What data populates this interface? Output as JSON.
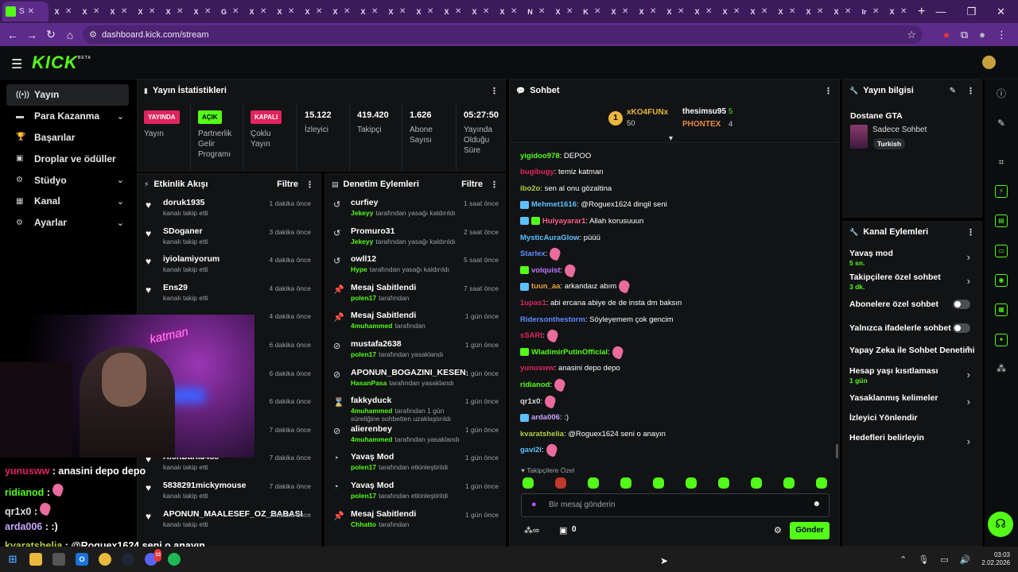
{
  "browser": {
    "active_tab_label": "S",
    "tabs": [
      "X",
      "X",
      "X",
      "X",
      "X",
      "X",
      "G",
      "X",
      "X",
      "X",
      "X",
      "X",
      "X",
      "X",
      "X",
      "X",
      "X",
      "N",
      "X",
      "K",
      "X",
      "X",
      "X",
      "X",
      "X",
      "X",
      "X",
      "X",
      "X",
      "Ir",
      "X"
    ],
    "url": "dashboard.kick.com/stream"
  },
  "logo": {
    "text": "KICK",
    "tag": "BETA"
  },
  "sidebar": {
    "items": [
      {
        "label": "Yayın",
        "icon": "broadcast-icon"
      },
      {
        "label": "Para Kazanma",
        "icon": "money-icon"
      },
      {
        "label": "Başarılar",
        "icon": "trophy-icon"
      },
      {
        "label": "Droplar ve ödüller",
        "icon": "gift-icon"
      },
      {
        "label": "Stüdyo",
        "icon": "studio-icon"
      },
      {
        "label": "Kanal",
        "icon": "channel-icon"
      },
      {
        "label": "Ayarlar",
        "icon": "gear-icon"
      }
    ]
  },
  "stats": {
    "title": "Yayın İstatistikleri",
    "cells": [
      {
        "badge": "YAYINDA",
        "label": "Yayın"
      },
      {
        "badge": "AÇIK",
        "label": "Partnerlik Gelir Programı"
      },
      {
        "badge": "KAPALI",
        "label": "Çoklu Yayın"
      },
      {
        "value": "15.122",
        "label": "İzleyici"
      },
      {
        "value": "419.420",
        "label": "Takipçi"
      },
      {
        "value": "1.626",
        "label": "Abone Sayısı"
      },
      {
        "value": "05:27:50",
        "label": "Yayında Olduğu Süre"
      }
    ]
  },
  "activity": {
    "title": "Etkinlik Akışı",
    "filter": "Filtre",
    "items": [
      {
        "name": "doruk1935",
        "sub": "kanalı takip etti",
        "time": "1 dakika önce"
      },
      {
        "name": "SDoganer",
        "sub": "kanalı takip etti",
        "time": "3 dakika önce"
      },
      {
        "name": "iyiolamiyorum",
        "sub": "kanalı takip etti",
        "time": "4 dakika önce"
      },
      {
        "name": "Ens29",
        "sub": "kanalı takip etti",
        "time": "4 dakika önce"
      },
      {
        "name": "",
        "sub": "",
        "time": "4 dakika önce"
      },
      {
        "name": "",
        "sub": "",
        "time": "6 dakika önce"
      },
      {
        "name": "",
        "sub": "",
        "time": "6 dakika önce"
      },
      {
        "name": "",
        "sub": "",
        "time": "6 dakika önce"
      },
      {
        "name": "",
        "sub": "",
        "time": "7 dakika önce"
      },
      {
        "name": "AlonDark3458",
        "sub": "kanalı takip etti",
        "time": "7 dakika önce"
      },
      {
        "name": "5838291mickymouse",
        "sub": "kanalı takip etti",
        "time": "7 dakika önce"
      },
      {
        "name": "APONUN_MAALESEF_OZ_BABASI",
        "sub": "kanalı takip etti",
        "time": "7 dakika önce"
      }
    ]
  },
  "moderation": {
    "title": "Denetim Eylemleri",
    "filter": "Filtre",
    "items": [
      {
        "icon": "undo-icon",
        "name": "curfiey",
        "mod": "Jekeyy",
        "action": "tarafından yasağı kaldırıldı",
        "time": "1 saat önce"
      },
      {
        "icon": "undo-icon",
        "name": "Promuro31",
        "mod": "Jekeyy",
        "action": "tarafından yasağı kaldırıldı",
        "time": "2 saat önce"
      },
      {
        "icon": "undo-icon",
        "name": "owll12",
        "mod": "Hype",
        "action": "tarafından yasağı kaldırıldı",
        "time": "5 saat önce"
      },
      {
        "icon": "pin-icon",
        "name": "Mesaj Sabitlendi",
        "mod": "polen17",
        "action": "tarafından",
        "time": "7 saat önce"
      },
      {
        "icon": "pin-icon",
        "name": "Mesaj Sabitlendi",
        "mod": "4muhammed",
        "action": "tarafından",
        "time": "1 gün önce"
      },
      {
        "icon": "ban-icon",
        "name": "mustafa2638",
        "mod": "polen17",
        "action": "tarafından yasaklandı",
        "time": "1 gün önce"
      },
      {
        "icon": "ban-icon",
        "name": "APONUN_BOGAZINI_KESEN",
        "mod": "HasanPasa",
        "action": "tarafından yasaklandı",
        "time": "1 gün önce"
      },
      {
        "icon": "hourglass-icon",
        "name": "fakkyduck",
        "mod": "4muhammed",
        "action": "tarafından 1 gün süreliğine sohbetten uzaklaştırıldı",
        "time": "1 gün önce"
      },
      {
        "icon": "ban-icon",
        "name": "alierenbey",
        "mod": "4muhammed",
        "action": "tarafından yasaklandı",
        "time": "1 gün önce"
      },
      {
        "icon": "snail-icon",
        "name": "Yavaş Mod",
        "mod": "polen17",
        "action": "tarafından etkinleştirildi",
        "time": "1 gün önce"
      },
      {
        "icon": "snail-icon",
        "name": "Yavaş Mod",
        "mod": "polen17",
        "action": "tarafından etkinleştirildi",
        "time": "1 gün önce"
      },
      {
        "icon": "pin-icon",
        "name": "Mesaj Sabitlendi",
        "mod": "Chhatto",
        "action": "tarafından",
        "time": "1 gün önce"
      }
    ]
  },
  "chat": {
    "title": "Sohbet",
    "leaders": [
      {
        "name": "xKO4FUNx",
        "count": "50"
      },
      {
        "name": "thesimsu95",
        "count": "5"
      },
      {
        "name": "PHONTEX",
        "count": "4"
      }
    ],
    "messages": [
      {
        "user": "yigidoo978",
        "color": "#53fc18",
        "text": ": DEPOO"
      },
      {
        "user": "bugibugy",
        "color": "#e0245e",
        "text": ": temiz katman"
      },
      {
        "user": "ibo2o",
        "color": "#b5cf3e",
        "text": ": sen al onu gözaltina"
      },
      {
        "user": "Mehmet1616",
        "color": "#5ec1ff",
        "text": ": @Roguex1624 dingil seni",
        "badge": "b"
      },
      {
        "user": "Hulyayarar1",
        "color": "#ff5f8a",
        "text": ": Allah korusuuun",
        "badge": "bg"
      },
      {
        "user": "MysticAuraGlow",
        "color": "#5ec1ff",
        "text": ": püüü"
      },
      {
        "user": "Starlex",
        "color": "#5e8cff",
        "text": ":",
        "emote": true
      },
      {
        "user": "volquist",
        "color": "#c275ff",
        "text": ":",
        "emote": true,
        "badge": "g"
      },
      {
        "user": "tuun_aa",
        "color": "#e6a23c",
        "text": ": arkandaız abım",
        "emote": true,
        "badge": "b"
      },
      {
        "user": "1upas1",
        "color": "#e0245e",
        "text": ": abi ercana abiye de de insta dm baksın"
      },
      {
        "user": "Ridersonthestorm",
        "color": "#5e8cff",
        "text": ": Söyleyemem çok gencim"
      },
      {
        "user": "sSARI",
        "color": "#e0245e",
        "text": ":",
        "emote": true
      },
      {
        "user": "WladimirPutinOfficial",
        "color": "#53fc18",
        "text": ":",
        "emote": true,
        "badge": "g"
      },
      {
        "user": "yunusww",
        "color": "#e0245e",
        "text": ": anasini depo depo"
      },
      {
        "user": "ridianod",
        "color": "#53fc18",
        "text": ":",
        "emote": true
      },
      {
        "user": "qr1x0",
        "color": "#ddd",
        "text": ":",
        "emote": true
      },
      {
        "user": "arda006",
        "color": "#c9a6ff",
        "text": ": :)",
        "badge": "b"
      },
      {
        "user": "kvaratshelia",
        "color": "#b5cf3e",
        "text": ": @Roguex1624 seni o anayın"
      },
      {
        "user": "gavi2i",
        "color": "#5ec1ff",
        "text": ":",
        "emote": true
      }
    ],
    "followers_only": "Takipçilere Özel",
    "placeholder": "Bir mesaj gönderin",
    "points": "0",
    "send": "Gönder"
  },
  "overlay_chat": [
    {
      "user": "yunusww",
      "text": " : anasini depo depo"
    },
    {
      "user": "ridianod",
      "text": " :"
    },
    {
      "user": "qr1x0",
      "text": " :"
    },
    {
      "user": "arda006",
      "text": " : :)"
    },
    {
      "user": "kvaratshelia",
      "text": " : @Roguex1624 seni o anayın"
    }
  ],
  "webcam_neon": "katman",
  "stream_info": {
    "title": "Yayın bilgisi",
    "stream_title": "Dostane GTA",
    "category": "Sadece Sohbet",
    "tag": "Turkish"
  },
  "channel_actions": {
    "title": "Kanal Eylemleri",
    "items": [
      {
        "label": "Yavaş mod",
        "sub": "5 sn.",
        "ctl": "arrow"
      },
      {
        "label": "Takipçilere özel sohbet",
        "sub": "3 dk.",
        "ctl": "arrow"
      },
      {
        "label": "Abonelere özel sohbet",
        "sub": "",
        "ctl": "toggle"
      },
      {
        "label": "Yalnızca ifadelerle sohbet",
        "sub": "",
        "ctl": "toggle"
      },
      {
        "label": "Yapay Zeka ile Sohbet Denetimi",
        "sub": "",
        "ctl": "ext"
      },
      {
        "label": "Hesap yaşı kısıtlaması",
        "sub": "1 gün",
        "ctl": "arrow"
      },
      {
        "label": "Yasaklanmış kelimeler",
        "sub": "",
        "ctl": "arrow"
      },
      {
        "label": "İzleyici Yönlendir",
        "sub": "",
        "ctl": "none"
      },
      {
        "label": "Hedefleri belirleyin",
        "sub": "",
        "ctl": "arrow"
      }
    ]
  },
  "taskbar": {
    "time": "03:03",
    "date": "2.02.2026",
    "discord_badge": "13"
  },
  "colors": {
    "accent": "#53fc18",
    "bg": "#111315",
    "browser": "#5d2c8a"
  }
}
